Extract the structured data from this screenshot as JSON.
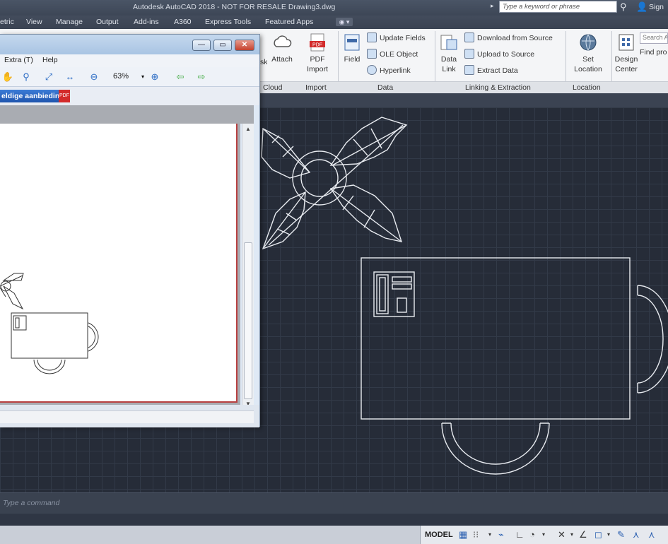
{
  "app": {
    "title": "Autodesk AutoCAD 2018 - NOT FOR RESALE    Drawing3.dwg",
    "search_placeholder": "Type a keyword or phrase",
    "sign_in": "Sign"
  },
  "tabs": [
    "etric",
    "View",
    "Manage",
    "Output",
    "Add-ins",
    "A360",
    "Express Tools",
    "Featured Apps"
  ],
  "ribbon": {
    "partial_left": "sk",
    "attach": "Attach",
    "pdf_import": {
      "icon_text": "PDF",
      "line1": "PDF",
      "line2": "Import"
    },
    "field": "Field",
    "update_fields": "Update Fields",
    "ole_object": "OLE Object",
    "hyperlink": "Hyperlink",
    "data_link": {
      "line1": "Data",
      "line2": "Link"
    },
    "download_from_source": "Download from Source",
    "upload_to_source": "Upload to Source",
    "extract_data": "Extract  Data",
    "set_location": {
      "line1": "Set",
      "line2": "Location"
    },
    "design_center": {
      "line1": "Design",
      "line2": "Center"
    },
    "search_field": "Search A",
    "find_text": "Find pro",
    "panels": [
      "Cloud",
      "Import",
      "Data",
      "Linking & Extraction",
      "Location"
    ]
  },
  "command_line": {
    "placeholder": "Type  a  command"
  },
  "status": {
    "model": "MODEL"
  },
  "viewer": {
    "menu": [
      "Extra (T)",
      "Help"
    ],
    "zoom": "63%",
    "address": "eldige aanbieding",
    "pdf_badge": "PDF"
  }
}
